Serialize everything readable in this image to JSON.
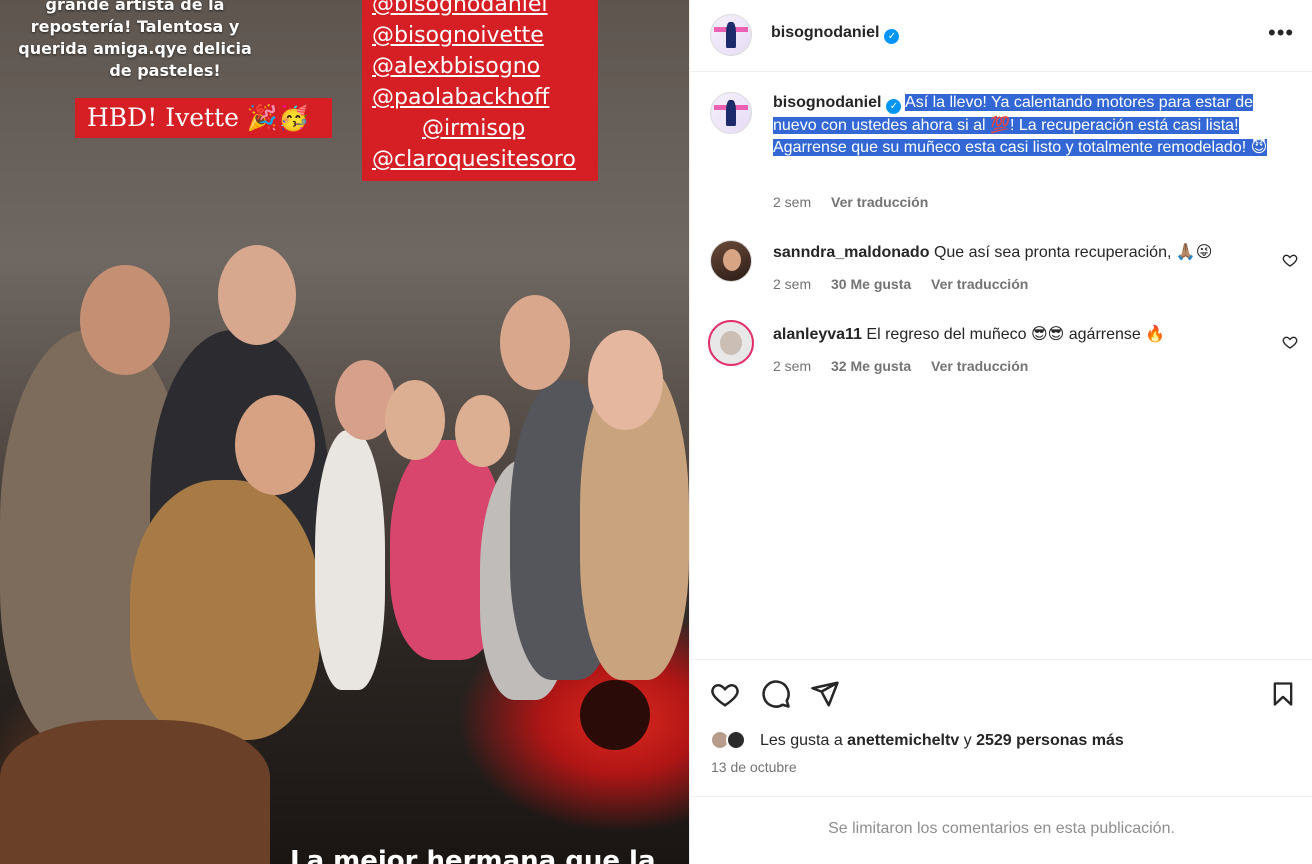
{
  "photo": {
    "story_text_lines": [
      "grande artista de la",
      "repostería! Talentosa y",
      "querida amiga.qye delicia",
      "de pasteles!"
    ],
    "hbd_label": "HBD! Ivette 🎉🥳",
    "tags": [
      "@bisognodaniel",
      "@bisognoivette",
      "@alexbbisogno",
      "@paolabackhoff",
      "@irmisop",
      "@claroquesitesoro"
    ],
    "bottom_caption": "La mejor hermana que la"
  },
  "header": {
    "username": "bisognodaniel",
    "verified_icon": "verified-badge-icon",
    "more_label": "•••"
  },
  "post": {
    "username": "bisognodaniel",
    "caption_parts": [
      "Así la llevo! Ya calentando motores para estar de nuevo con ustedes ahora si al ",
      "💯",
      "! La recuperación está casi lista! Agarrense que su muñeco esta casi listo y totalmente remodelado! ",
      "😈"
    ],
    "time": "2 sem",
    "translate": "Ver traducción"
  },
  "comments": [
    {
      "username": "sanndra_maldonado",
      "text": "Que así sea pronta recuperación, 🙏🏽😜",
      "time": "2 sem",
      "likes": "30 Me gusta",
      "translate": "Ver traducción"
    },
    {
      "username": "alanleyva11",
      "text": "El regreso del muñeco 😎😎 agárrense 🔥",
      "time": "2 sem",
      "likes": "32 Me gusta",
      "translate": "Ver traducción"
    }
  ],
  "actions": {
    "like_icon": "heart-icon",
    "comment_icon": "comment-icon",
    "share_icon": "send-icon",
    "save_icon": "bookmark-icon",
    "likes_prefix": "Les gusta a ",
    "likes_user": "anettemicheltv",
    "likes_mid": " y ",
    "likes_count": "2529 personas más",
    "date": "13 de octubre"
  },
  "footer": {
    "limited_text": "Se limitaron los comentarios en esta publicación."
  },
  "colors": {
    "accent": "#0095f6",
    "selection": "#3367d6",
    "story_red": "#d61f25"
  }
}
